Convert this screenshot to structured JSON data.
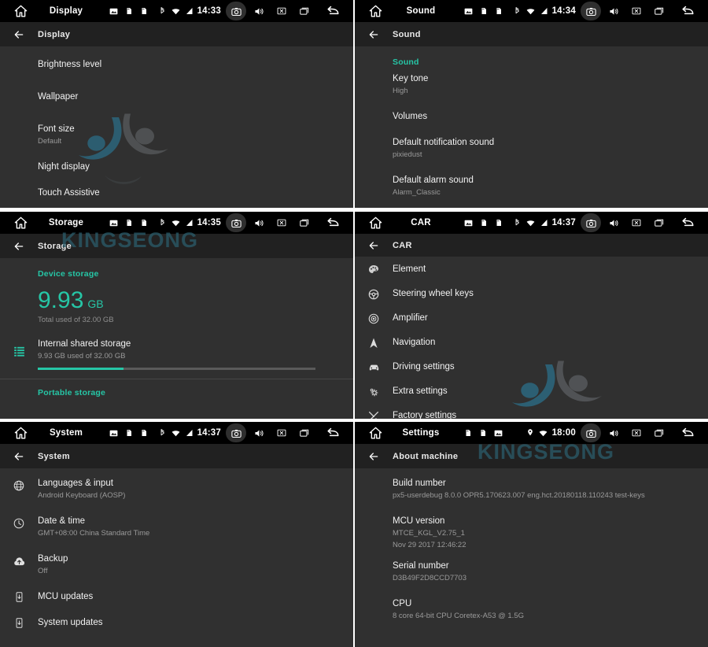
{
  "watermark": {
    "brand_text": "KINGSEONG",
    "brand_color": "#2b5f6e",
    "logo_blue": "#2b6e88",
    "logo_gray": "#6a6f73"
  },
  "colors": {
    "accent_teal": "#26c6a6",
    "panel_bg": "#303030",
    "header_bg": "#212121",
    "statusbar_bg": "#000000",
    "title_text": "#f2f2f2",
    "subtitle_text": "#9a9a9a"
  },
  "panels": [
    {
      "id": "display",
      "statusbar": {
        "title": "Display",
        "clock": "14:33",
        "left_icons": [
          "image-icon",
          "sdcard-icon",
          "sdcard-icon"
        ],
        "sys_icons": [
          "bluetooth-icon",
          "wifi-icon",
          "signal-icon"
        ],
        "nav_icons": [
          "camera-icon",
          "volume-icon",
          "close-icon",
          "recents-icon",
          "back-icon"
        ],
        "home_icon": "home-icon"
      },
      "header": {
        "back_icon": "arrow-left-icon",
        "title": "Display"
      },
      "section_label": "",
      "items": [
        {
          "title": "Brightness level",
          "subtitle": ""
        },
        {
          "title": "Wallpaper",
          "subtitle": ""
        },
        {
          "title": "Font size",
          "subtitle": "Default"
        },
        {
          "title": "Night display",
          "subtitle": ""
        },
        {
          "title": "Touch Assistive",
          "subtitle": ""
        }
      ]
    },
    {
      "id": "sound",
      "statusbar": {
        "title": "Sound",
        "clock": "14:34",
        "left_icons": [
          "image-icon",
          "sdcard-icon",
          "sdcard-icon"
        ],
        "sys_icons": [
          "bluetooth-icon",
          "wifi-icon",
          "signal-icon"
        ],
        "nav_icons": [
          "camera-icon",
          "volume-icon",
          "close-icon",
          "recents-icon",
          "back-icon"
        ],
        "home_icon": "home-icon"
      },
      "header": {
        "back_icon": "arrow-left-icon",
        "title": "Sound"
      },
      "section_label": "Sound",
      "items": [
        {
          "title": "Key tone",
          "subtitle": "High"
        },
        {
          "title": "Volumes",
          "subtitle": ""
        },
        {
          "title": "Default notification sound",
          "subtitle": "pixiedust"
        },
        {
          "title": "Default alarm sound",
          "subtitle": "Alarm_Classic"
        }
      ]
    },
    {
      "id": "storage",
      "statusbar": {
        "title": "Storage",
        "clock": "14:35",
        "left_icons": [
          "image-icon",
          "sdcard-icon",
          "sdcard-icon"
        ],
        "sys_icons": [
          "bluetooth-icon",
          "wifi-icon",
          "signal-icon"
        ],
        "nav_icons": [
          "camera-icon",
          "volume-icon",
          "close-icon",
          "recents-icon",
          "back-icon"
        ],
        "home_icon": "home-icon"
      },
      "header": {
        "back_icon": "arrow-left-icon",
        "title": "Storage"
      },
      "section_label": "Device storage",
      "used_value": "9.93",
      "used_unit": "GB",
      "total_used_label": "Total used of 32.00 GB",
      "internal": {
        "icon": "storage-list-icon",
        "title": "Internal shared storage",
        "subtitle": "9.93 GB used of 32.00 GB",
        "progress_percent": 31
      },
      "portable_label": "Portable storage"
    },
    {
      "id": "car",
      "statusbar": {
        "title": "CAR",
        "clock": "14:37",
        "left_icons": [
          "image-icon",
          "sdcard-icon",
          "sdcard-icon"
        ],
        "sys_icons": [
          "bluetooth-icon",
          "wifi-icon",
          "signal-icon"
        ],
        "nav_icons": [
          "camera-icon",
          "volume-icon",
          "close-icon",
          "recents-icon",
          "back-icon"
        ],
        "home_icon": "home-icon"
      },
      "header": {
        "back_icon": "arrow-left-icon",
        "title": "CAR"
      },
      "items": [
        {
          "icon": "palette-icon",
          "title": "Element",
          "subtitle": ""
        },
        {
          "icon": "steering-wheel-icon",
          "title": "Steering wheel keys",
          "subtitle": ""
        },
        {
          "icon": "amplifier-icon",
          "title": "Amplifier",
          "subtitle": ""
        },
        {
          "icon": "navigation-arrow-icon",
          "title": "Navigation",
          "subtitle": ""
        },
        {
          "icon": "car-icon",
          "title": "Driving settings",
          "subtitle": ""
        },
        {
          "icon": "gears-icon",
          "title": "Extra settings",
          "subtitle": ""
        },
        {
          "icon": "tools-icon",
          "title": "Factory settings",
          "subtitle": ""
        }
      ]
    },
    {
      "id": "system",
      "statusbar": {
        "title": "System",
        "clock": "14:37",
        "left_icons": [
          "image-icon",
          "sdcard-icon",
          "sdcard-icon"
        ],
        "sys_icons": [
          "bluetooth-icon",
          "wifi-icon",
          "signal-icon"
        ],
        "nav_icons": [
          "camera-icon",
          "volume-icon",
          "close-icon",
          "recents-icon",
          "back-icon"
        ],
        "home_icon": "home-icon"
      },
      "header": {
        "back_icon": "arrow-left-icon",
        "title": "System"
      },
      "items": [
        {
          "icon": "globe-icon",
          "title": "Languages & input",
          "subtitle": "Android Keyboard (AOSP)"
        },
        {
          "icon": "clock-icon",
          "title": "Date & time",
          "subtitle": "GMT+08:00 China Standard Time"
        },
        {
          "icon": "cloud-upload-icon",
          "title": "Backup",
          "subtitle": "Off"
        },
        {
          "icon": "device-download-icon",
          "title": "MCU updates",
          "subtitle": ""
        },
        {
          "icon": "device-download-icon",
          "title": "System updates",
          "subtitle": ""
        }
      ]
    },
    {
      "id": "about",
      "statusbar": {
        "title": "Settings",
        "clock": "18:00",
        "left_icons": [
          "sdcard-icon",
          "sdcard-icon",
          "image-icon"
        ],
        "sys_icons": [
          "location-pin-icon",
          "wifi-icon"
        ],
        "nav_icons": [
          "camera-icon",
          "volume-icon",
          "close-icon",
          "recents-icon",
          "back-icon"
        ],
        "home_icon": "home-icon"
      },
      "header": {
        "back_icon": "arrow-left-icon",
        "title": "About machine"
      },
      "items": [
        {
          "title": "Build number",
          "subtitle": "px5-userdebug 8.0.0 OPR5.170623.007 eng.hct.20180118.110243 test-keys"
        },
        {
          "title": "MCU version",
          "subtitle": "MTCE_KGL_V2.75_1",
          "subtitle2": "Nov 29 2017 12:46:22"
        },
        {
          "title": "Serial number",
          "subtitle": "D3B49F2D8CCD7703"
        },
        {
          "title": "CPU",
          "subtitle": "8 core 64-bit CPU Coretex-A53 @ 1.5G"
        }
      ]
    }
  ]
}
